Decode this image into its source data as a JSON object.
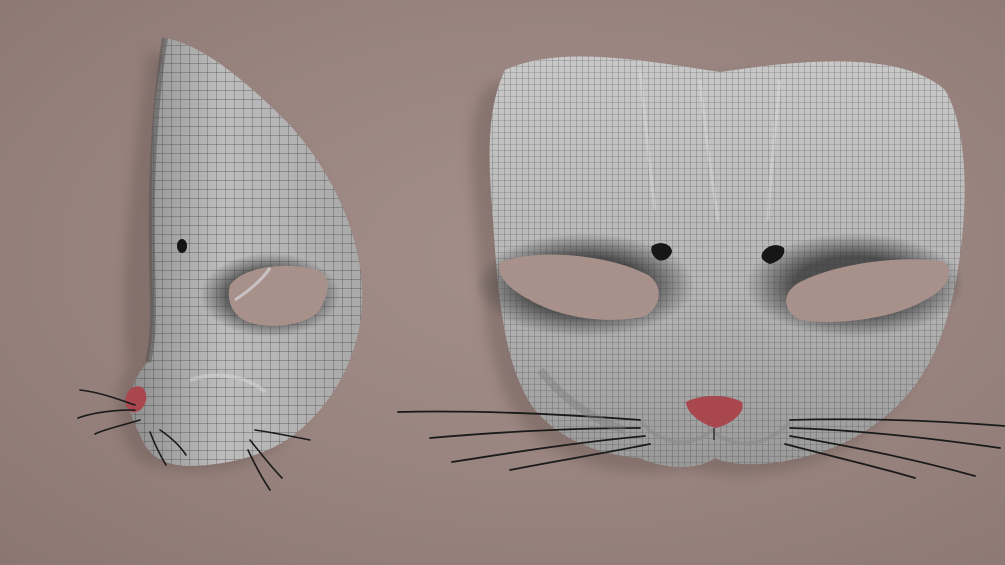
{
  "image": {
    "kind": "3d-render-wireframe",
    "subject": "cat mask",
    "views": [
      "side",
      "front"
    ]
  },
  "colors": {
    "backdrop": "#98837e",
    "mask_surface": "#bdbdbd",
    "mask_shadow": "#6f6f6f",
    "wireframe": "#2a2a2a",
    "nose": "#a8474e",
    "whisker": "#1a1a1a",
    "eye_hole": "#a8918b"
  }
}
